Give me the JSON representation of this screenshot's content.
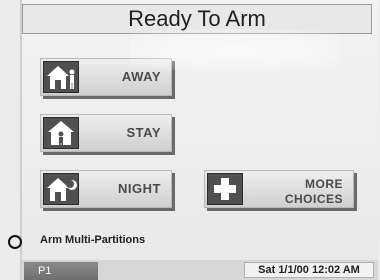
{
  "header": {
    "title": "Ready To Arm"
  },
  "buttons": {
    "away": {
      "label": "AWAY",
      "icon": "house-person-away-icon"
    },
    "stay": {
      "label": "STAY",
      "icon": "house-person-stay-icon"
    },
    "night": {
      "label": "NIGHT",
      "icon": "house-moon-night-icon"
    },
    "more": {
      "label_line1": "MORE",
      "label_line2": "CHOICES",
      "icon": "plus-icon"
    }
  },
  "partitions": {
    "label": "Arm Multi-Partitions",
    "selected": false
  },
  "status": {
    "partition": "P1",
    "datetime": "Sat 1/1/00 12:02 AM"
  },
  "colors": {
    "background": "#ececec",
    "button": "#dcdcdc",
    "icon_box": "#505050",
    "status_tab": "#7a7a7a"
  }
}
